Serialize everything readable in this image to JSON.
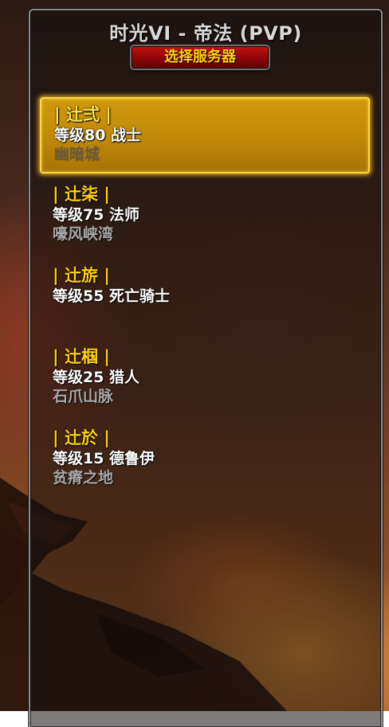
{
  "realm": {
    "title": "时光VI - 帝法 (PVP)",
    "change_server_label": "选择服务器"
  },
  "characters": [
    {
      "name": "| 辻弍 |",
      "level": "等级80 战士",
      "location": "幽暗城",
      "selected": true
    },
    {
      "name": "| 辻柒 |",
      "level": "等级75 法师",
      "location": "嚎风峡湾",
      "selected": false
    },
    {
      "name": "| 辻旂 |",
      "level": "等级55 死亡骑士",
      "location": "",
      "selected": false
    },
    {
      "name": "| 辻椢 |",
      "level": "等级25 猎人",
      "location": "石爪山脉",
      "selected": false
    },
    {
      "name": "| 辻於 |",
      "level": "等级15 德鲁伊",
      "location": "贫瘠之地",
      "selected": false
    }
  ],
  "colors": {
    "name_gold": "#ffd200",
    "level_white": "#ffffff",
    "location_gray": "#a8a8a8",
    "selected_bg": "#c18a08",
    "selected_border": "#ffd83a",
    "button_red": "#8c0606"
  }
}
